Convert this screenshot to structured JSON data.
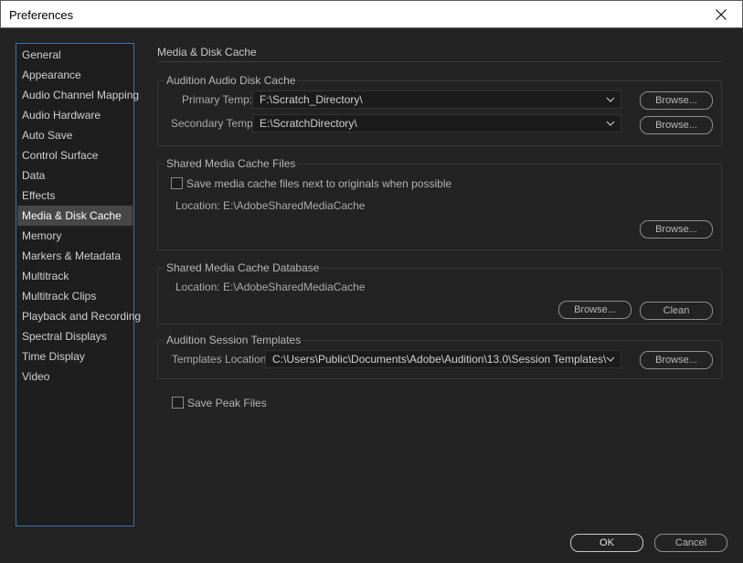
{
  "window": {
    "title": "Preferences",
    "close_icon": "close-icon"
  },
  "sidebar": {
    "items": [
      {
        "label": "General"
      },
      {
        "label": "Appearance"
      },
      {
        "label": "Audio Channel Mapping"
      },
      {
        "label": "Audio Hardware"
      },
      {
        "label": "Auto Save"
      },
      {
        "label": "Control Surface"
      },
      {
        "label": "Data"
      },
      {
        "label": "Effects"
      },
      {
        "label": "Media & Disk Cache",
        "selected": true
      },
      {
        "label": "Memory"
      },
      {
        "label": "Markers & Metadata"
      },
      {
        "label": "Multitrack"
      },
      {
        "label": "Multitrack Clips"
      },
      {
        "label": "Playback and Recording"
      },
      {
        "label": "Spectral Displays"
      },
      {
        "label": "Time Display"
      },
      {
        "label": "Video"
      }
    ]
  },
  "main": {
    "title": "Media & Disk Cache",
    "disk_cache": {
      "title": "Audition Audio Disk Cache",
      "primary_label": "Primary Temp:",
      "primary_value": "F:\\Scratch_Directory\\",
      "secondary_label": "Secondary Temp:",
      "secondary_value": "E:\\ScratchDirectory\\",
      "browse_label": "Browse..."
    },
    "shared_files": {
      "title": "Shared Media Cache Files",
      "checkbox_label": "Save media cache files next to originals when possible",
      "checked": false,
      "location": "Location: E:\\AdobeSharedMediaCache",
      "browse_label": "Browse..."
    },
    "shared_db": {
      "title": "Shared Media Cache Database",
      "location": "Location: E:\\AdobeSharedMediaCache",
      "browse_label": "Browse...",
      "clean_label": "Clean"
    },
    "session_templates": {
      "title": "Audition Session Templates",
      "location_label": "Templates Location:",
      "location_value": "C:\\Users\\Public\\Documents\\Adobe\\Audition\\13.0\\Session Templates\\",
      "browse_label": "Browse..."
    },
    "save_peak": {
      "label": "Save Peak Files",
      "checked": false
    }
  },
  "footer": {
    "ok_label": "OK",
    "cancel_label": "Cancel"
  },
  "colors": {
    "background": "#232323",
    "sidebar_border": "#3f6fb0",
    "selected_item": "#474747"
  }
}
